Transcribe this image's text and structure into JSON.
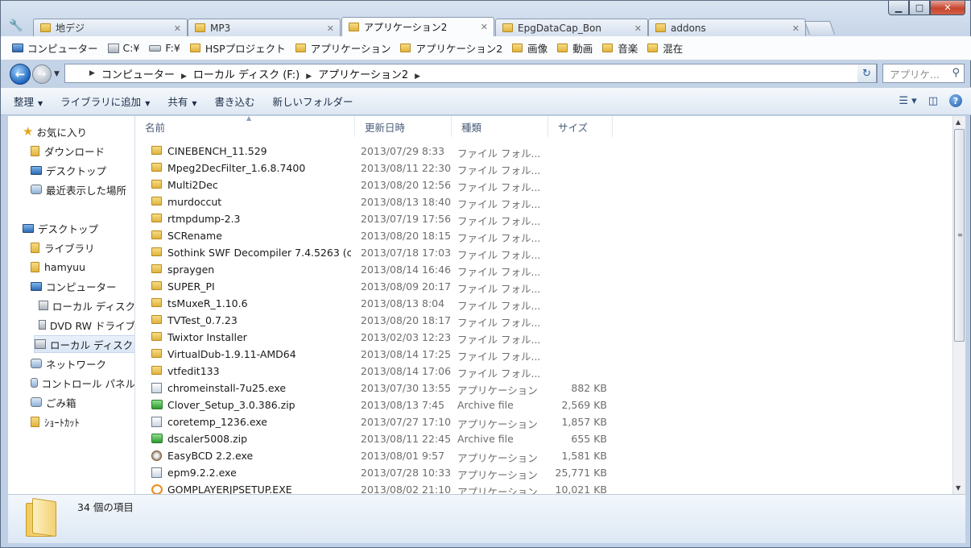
{
  "window": {
    "caption_buttons": {
      "minimize": "▁",
      "maximize": "□",
      "close": "✕"
    }
  },
  "tabs": [
    {
      "label": "地デジ",
      "active": false
    },
    {
      "label": "MP3",
      "active": false
    },
    {
      "label": "アプリケーション2",
      "active": true
    },
    {
      "label": "EpgDataCap_Bon",
      "active": false
    },
    {
      "label": "addons",
      "active": false
    }
  ],
  "favorites": [
    {
      "label": "コンピューター",
      "icon": "computer-icon"
    },
    {
      "label": "C:¥",
      "icon": "drive-c-icon"
    },
    {
      "label": "F:¥",
      "icon": "drive-icon"
    },
    {
      "label": "HSPプロジェクト",
      "icon": "folder-icon"
    },
    {
      "label": "アプリケーション",
      "icon": "folder-icon"
    },
    {
      "label": "アプリケーション2",
      "icon": "folder-icon"
    },
    {
      "label": "画像",
      "icon": "folder-icon"
    },
    {
      "label": "動画",
      "icon": "folder-icon"
    },
    {
      "label": "音楽",
      "icon": "folder-icon"
    },
    {
      "label": "混在",
      "icon": "folder-icon"
    }
  ],
  "address": {
    "crumbs": [
      "コンピューター",
      "ローカル ディスク (F:)",
      "アプリケーション2"
    ],
    "search_placeholder": "アプリケ..."
  },
  "commands": [
    "整理",
    "ライブラリに追加",
    "共有",
    "書き込む",
    "新しいフォルダー"
  ],
  "nav": [
    {
      "label": "お気に入り",
      "icon": "star-icon",
      "indent": 0
    },
    {
      "label": "ダウンロード",
      "icon": "downloads-folder-icon",
      "indent": 1
    },
    {
      "label": "デスクトップ",
      "icon": "desktop-icon",
      "indent": 1
    },
    {
      "label": "最近表示した場所",
      "icon": "recent-places-icon",
      "indent": 1
    },
    {
      "label": "デスクトップ",
      "icon": "desktop-icon",
      "indent": 0
    },
    {
      "label": "ライブラリ",
      "icon": "library-icon",
      "indent": 1
    },
    {
      "label": "hamyuu",
      "icon": "user-folder-icon",
      "indent": 1
    },
    {
      "label": "コンピューター",
      "icon": "computer-icon",
      "indent": 1
    },
    {
      "label": "ローカル ディスク",
      "icon": "local-disk-icon",
      "indent": 2
    },
    {
      "label": "DVD RW ドライブ",
      "icon": "dvd-drive-icon",
      "indent": 2
    },
    {
      "label": "ローカル ディスク",
      "icon": "local-disk-icon",
      "indent": 2,
      "selected": true
    },
    {
      "label": "ネットワーク",
      "icon": "network-icon",
      "indent": 1
    },
    {
      "label": "コントロール パネル",
      "icon": "control-panel-icon",
      "indent": 1
    },
    {
      "label": "ごみ箱",
      "icon": "recycle-bin-icon",
      "indent": 1
    },
    {
      "label": "ｼｮｰﾄｶｯﾄ",
      "icon": "folder-icon",
      "indent": 1
    }
  ],
  "columns": [
    "名前",
    "更新日時",
    "種類",
    "サイズ"
  ],
  "files": [
    {
      "name": "CINEBENCH_11.529",
      "date": "2013/07/29 8:33",
      "type": "ファイル フォル...",
      "size": "",
      "icon": "folder"
    },
    {
      "name": "Mpeg2DecFilter_1.6.8.7400",
      "date": "2013/08/11 22:30",
      "type": "ファイル フォル...",
      "size": "",
      "icon": "folder"
    },
    {
      "name": "Multi2Dec",
      "date": "2013/08/20 12:56",
      "type": "ファイル フォル...",
      "size": "",
      "icon": "folder"
    },
    {
      "name": "murdoccut",
      "date": "2013/08/13 18:40",
      "type": "ファイル フォル...",
      "size": "",
      "icon": "folder"
    },
    {
      "name": "rtmpdump-2.3",
      "date": "2013/07/19 17:56",
      "type": "ファイル フォル...",
      "size": "",
      "icon": "folder"
    },
    {
      "name": "SCRename",
      "date": "2013/08/20 18:15",
      "type": "ファイル フォル...",
      "size": "",
      "icon": "folder"
    },
    {
      "name": "Sothink SWF Decompiler 7.4.5263 (c...",
      "date": "2013/07/18 17:03",
      "type": "ファイル フォル...",
      "size": "",
      "icon": "folder"
    },
    {
      "name": "spraygen",
      "date": "2013/08/14 16:46",
      "type": "ファイル フォル...",
      "size": "",
      "icon": "folder"
    },
    {
      "name": "SUPER_PI",
      "date": "2013/08/09 20:17",
      "type": "ファイル フォル...",
      "size": "",
      "icon": "folder"
    },
    {
      "name": "tsMuxeR_1.10.6",
      "date": "2013/08/13 8:04",
      "type": "ファイル フォル...",
      "size": "",
      "icon": "folder"
    },
    {
      "name": "TVTest_0.7.23",
      "date": "2013/08/20 18:17",
      "type": "ファイル フォル...",
      "size": "",
      "icon": "folder"
    },
    {
      "name": "Twixtor Installer",
      "date": "2013/02/03 12:23",
      "type": "ファイル フォル...",
      "size": "",
      "icon": "folder"
    },
    {
      "name": "VirtualDub-1.9.11-AMD64",
      "date": "2013/08/14 17:25",
      "type": "ファイル フォル...",
      "size": "",
      "icon": "folder"
    },
    {
      "name": "vtfedit133",
      "date": "2013/08/14 17:06",
      "type": "ファイル フォル...",
      "size": "",
      "icon": "folder"
    },
    {
      "name": "chromeinstall-7u25.exe",
      "date": "2013/07/30 13:55",
      "type": "アプリケーション",
      "size": "882 KB",
      "icon": "exe"
    },
    {
      "name": "Clover_Setup_3.0.386.zip",
      "date": "2013/08/13 7:45",
      "type": "Archive file",
      "size": "2,569 KB",
      "icon": "zip"
    },
    {
      "name": "coretemp_1236.exe",
      "date": "2013/07/27 17:10",
      "type": "アプリケーション",
      "size": "1,857 KB",
      "icon": "exe"
    },
    {
      "name": "dscaler5008.zip",
      "date": "2013/08/11 22:45",
      "type": "Archive file",
      "size": "655 KB",
      "icon": "zip"
    },
    {
      "name": "EasyBCD 2.2.exe",
      "date": "2013/08/01 9:57",
      "type": "アプリケーション",
      "size": "1,581 KB",
      "icon": "easybcd"
    },
    {
      "name": "epm9.2.2.exe",
      "date": "2013/07/28 10:33",
      "type": "アプリケーション",
      "size": "25,771 KB",
      "icon": "exe"
    },
    {
      "name": "GOMPLAYERJPSETUP.EXE",
      "date": "2013/08/02 21:10",
      "type": "アプリケーション",
      "size": "10,021 KB",
      "icon": "gom"
    }
  ],
  "status": {
    "item_count": "34 個の項目"
  }
}
